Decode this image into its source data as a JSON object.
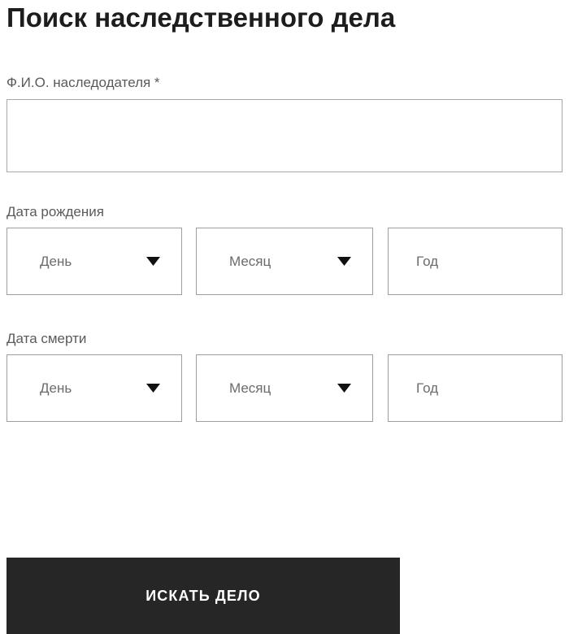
{
  "page": {
    "title": "Поиск наследственного дела",
    "accent_color": "#262626",
    "border_color": "#9e9e9e",
    "label_color": "#5a5a5a",
    "placeholder_color": "#6b6b6b"
  },
  "form": {
    "fio": {
      "label": "Ф.И.О. наследодателя *",
      "required_mark": "*",
      "value": "",
      "placeholder": ""
    },
    "birth_date": {
      "label": "Дата рождения",
      "day": {
        "selected": "День",
        "caret": "chevron-down-icon"
      },
      "month": {
        "selected": "Месяц",
        "caret": "chevron-down-icon"
      },
      "year": {
        "value": "",
        "placeholder": "Год"
      }
    },
    "death_date": {
      "label": "Дата смерти",
      "day": {
        "selected": "День",
        "caret": "chevron-down-icon"
      },
      "month": {
        "selected": "Месяц",
        "caret": "chevron-down-icon"
      },
      "year": {
        "value": "",
        "placeholder": "Год"
      }
    }
  },
  "actions": {
    "submit_label": "ИСКАТЬ ДЕЛО"
  }
}
